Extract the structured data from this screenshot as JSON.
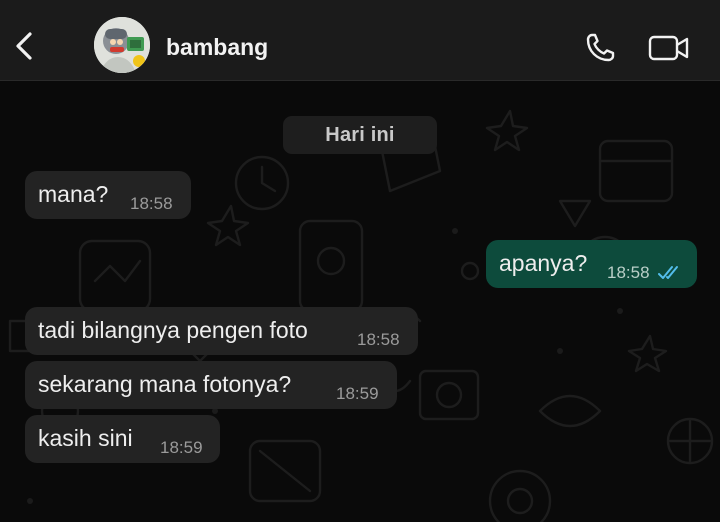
{
  "header": {
    "contact_name": "bambang",
    "back_icon": "chevron-left-icon",
    "call_icon": "phone-icon",
    "video_icon": "video-camera-icon"
  },
  "chat": {
    "date_label": "Hari ini",
    "messages": [
      {
        "direction": "incoming",
        "text": "mana?",
        "time": "18:58"
      },
      {
        "direction": "outgoing",
        "text": "apanya?",
        "time": "18:58",
        "status": "read"
      },
      {
        "direction": "incoming",
        "text": "tadi bilangnya pengen foto",
        "time": "18:58"
      },
      {
        "direction": "incoming",
        "text": "sekarang mana fotonya?",
        "time": "18:59"
      },
      {
        "direction": "incoming",
        "text": "kasih sini",
        "time": "18:59"
      }
    ]
  },
  "colors": {
    "header_bg": "#1b1b1b",
    "chat_bg": "#0a0a0a",
    "incoming_bubble": "#232323",
    "outgoing_bubble": "#0d4b3c",
    "read_ticks": "#53bdeb",
    "text": "#eeeeee",
    "time": "#9b9b9b"
  }
}
